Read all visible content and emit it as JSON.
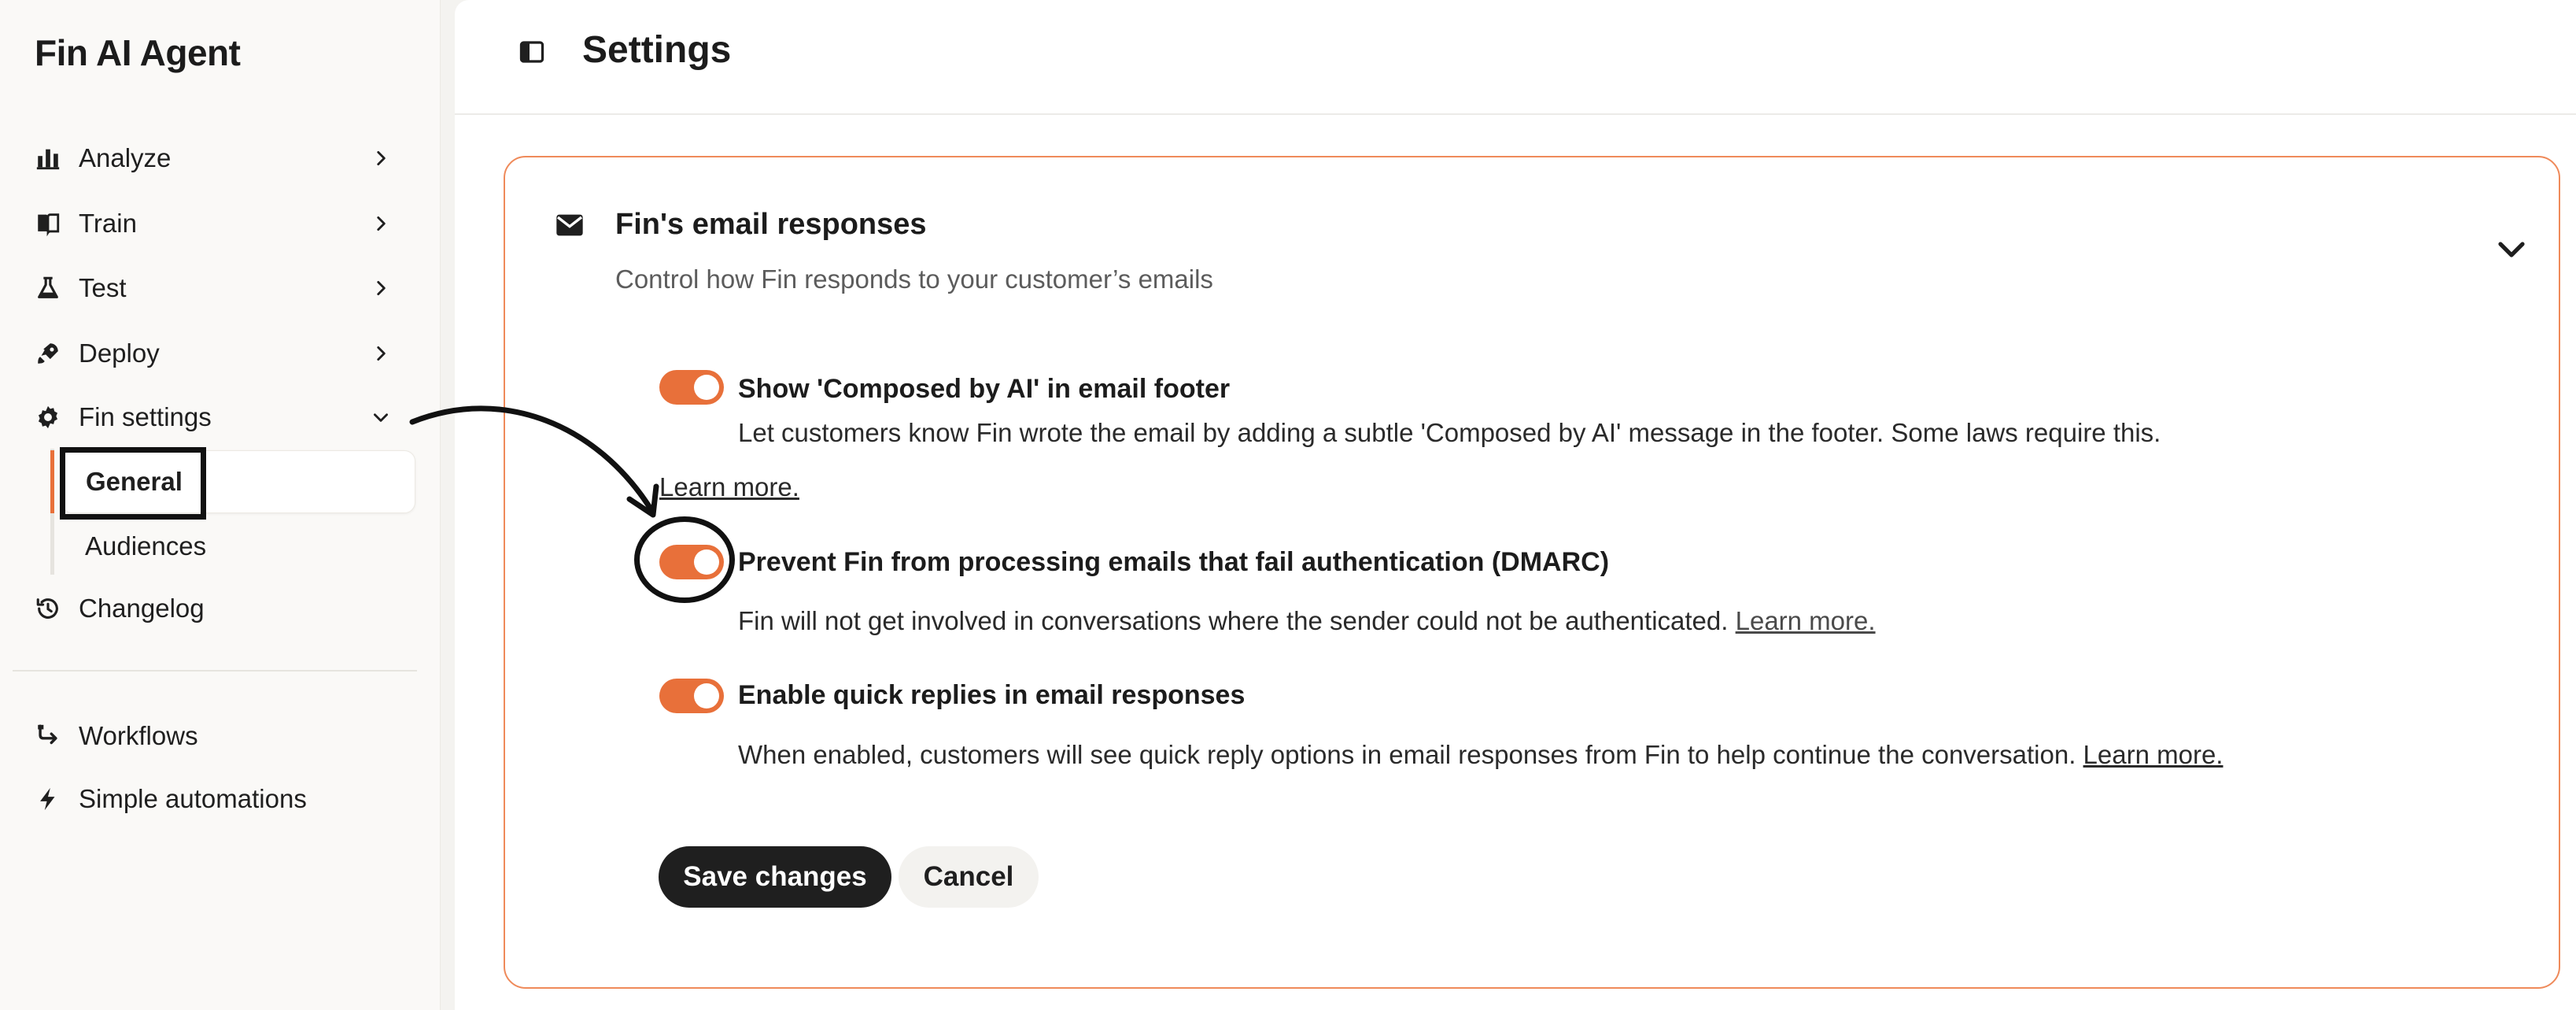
{
  "app": {
    "title": "Fin AI Agent"
  },
  "sidebar": {
    "items": [
      {
        "label": "Analyze",
        "icon": "bar-chart-icon",
        "expandable": true
      },
      {
        "label": "Train",
        "icon": "book-icon",
        "expandable": true
      },
      {
        "label": "Test",
        "icon": "flask-icon",
        "expandable": true
      },
      {
        "label": "Deploy",
        "icon": "rocket-icon",
        "expandable": true
      },
      {
        "label": "Fin settings",
        "icon": "gear-icon",
        "expanded": true
      }
    ],
    "subitems": [
      {
        "label": "General",
        "active": true
      },
      {
        "label": "Audiences",
        "active": false
      }
    ],
    "changelog": {
      "label": "Changelog",
      "icon": "history-icon"
    },
    "bottom_items": [
      {
        "label": "Workflows",
        "icon": "workflow-icon"
      },
      {
        "label": "Simple automations",
        "icon": "bolt-icon"
      }
    ]
  },
  "header": {
    "title": "Settings",
    "panel_toggle_icon": "sidebar-toggle-icon"
  },
  "card": {
    "title": "Fin's email responses",
    "subtitle": "Control how Fin responds to your customer’s emails",
    "icon": "mail-icon",
    "settings": [
      {
        "title": "Show 'Composed by AI' in email footer",
        "description": "Let customers know Fin wrote the email by adding a subtle 'Composed by AI' message in the footer. Some laws require this.",
        "link": "Learn more.",
        "enabled": true
      },
      {
        "title": "Prevent Fin from processing emails that fail authentication (DMARC)",
        "description": "Fin will not get involved in conversations where the sender could not be authenticated.",
        "link": "Learn more.",
        "enabled": true
      },
      {
        "title": "Enable quick replies in email responses",
        "description": "When enabled, customers will see quick reply options in email responses from Fin to help continue the conversation.",
        "link": "Learn more.",
        "enabled": true
      }
    ],
    "save_label": "Save changes",
    "cancel_label": "Cancel"
  },
  "colors": {
    "accent": "#e8703a",
    "card_border": "#ef8a5a",
    "primary_button": "#1f1f1f"
  }
}
